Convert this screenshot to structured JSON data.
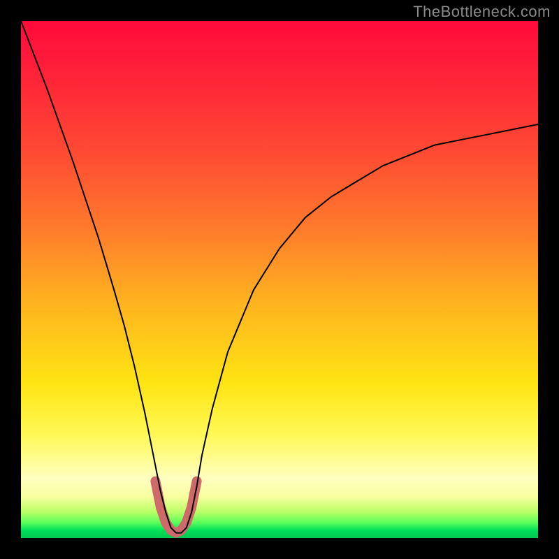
{
  "watermark": "TheBottleneck.com",
  "chart_data": {
    "type": "line",
    "title": "",
    "xlabel": "",
    "ylabel": "",
    "xlim": [
      0,
      100
    ],
    "ylim": [
      0,
      100
    ],
    "grid": false,
    "background": "vertical-gradient red→yellow→green",
    "series": [
      {
        "name": "bottleneck-curve",
        "stroke": "#000000",
        "x": [
          0,
          5,
          10,
          15,
          18,
          20,
          22,
          24,
          26,
          27,
          28,
          29,
          30,
          31,
          32,
          33,
          34,
          35,
          37,
          40,
          45,
          50,
          55,
          60,
          65,
          70,
          75,
          80,
          85,
          90,
          95,
          100
        ],
        "values": [
          100,
          87,
          73,
          58,
          48,
          41,
          33,
          24,
          14,
          9,
          5,
          2,
          1,
          1,
          2,
          5,
          10,
          16,
          25,
          36,
          48,
          56,
          62,
          66,
          69,
          72,
          74,
          76,
          77,
          78,
          79,
          80
        ]
      },
      {
        "name": "trough-marker",
        "stroke": "#cf6a6a",
        "stroke_width": 14,
        "x": [
          26,
          27,
          28,
          29,
          30,
          31,
          32,
          33,
          34
        ],
        "values": [
          11,
          6,
          3,
          1.5,
          1,
          1.5,
          3,
          6,
          11
        ]
      }
    ],
    "annotations": []
  }
}
